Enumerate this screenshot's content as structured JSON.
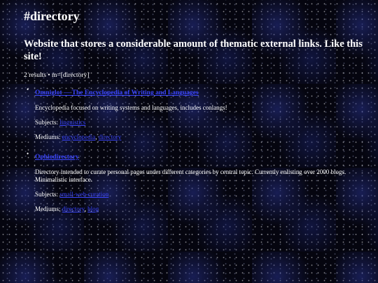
{
  "site": {
    "title": "#directory"
  },
  "page": {
    "heading": "Website that stores a considerable amount of thematic external links. Like this site!",
    "results_info": "2 results • m=[directory]"
  },
  "results": [
    {
      "title": "Omniglot — The Encyclopedia of Writing and Languages",
      "description": "Encyclopedia focused on writing systems and languages, includes conlangs!",
      "subjects_label": "Subjects:",
      "subjects": [
        "linguistics"
      ],
      "mediums_label": "Mediums:",
      "mediums": [
        "encyclopedia",
        "directory"
      ]
    },
    {
      "title": "Ophiodirectory",
      "description": "Directory intended to curate personal pages under different categories by central topic. Currently enlisting over 2000 blogs. Minimalistic interface.",
      "subjects_label": "Subjects:",
      "subjects": [
        "small-web-curation"
      ],
      "mediums_label": "Mediums:",
      "mediums": [
        "directory",
        "blog"
      ]
    }
  ],
  "colors": {
    "link": "#3b46ff",
    "text": "#ffffff",
    "background": "#05050f"
  }
}
